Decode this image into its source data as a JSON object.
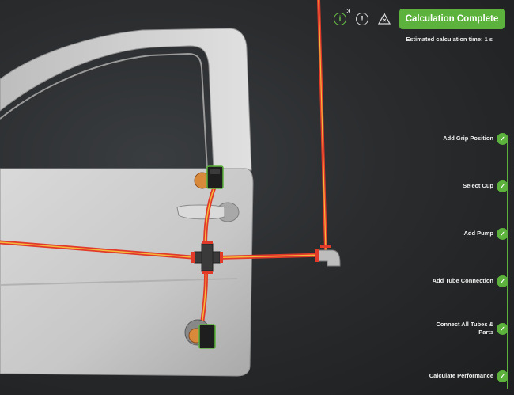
{
  "toolbar": {
    "info_glyph": "i",
    "info_badge": "3",
    "warning_glyph": "!",
    "triangle_glyph": "!"
  },
  "calculation": {
    "button_label": "Calculation Complete",
    "estimated_time": "Estimated calculation time: 1 s"
  },
  "steps": [
    {
      "label": "Add Grip Position",
      "status": "complete"
    },
    {
      "label": "Select Cup",
      "status": "complete"
    },
    {
      "label": "Add Pump",
      "status": "complete"
    },
    {
      "label": "Add Tube Connection",
      "status": "complete"
    },
    {
      "label_line1": "Connect All Tubes &",
      "label_line2": "Parts",
      "status": "complete"
    },
    {
      "label": "Calculate Performance",
      "status": "complete"
    }
  ],
  "check_glyph": "✓",
  "colors": {
    "accent_green": "#5cb23c",
    "tube_red": "#e23a2a",
    "tube_core": "#f4b93a",
    "door_gray": "#cfcfcf"
  }
}
